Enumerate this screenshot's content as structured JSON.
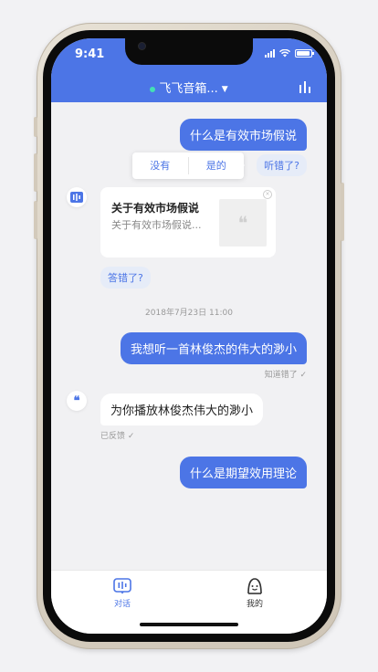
{
  "status_bar": {
    "time": "9:41"
  },
  "header": {
    "device_name": "飞飞音箱...",
    "online_color": "#43e0b4"
  },
  "messages": [
    {
      "role": "user",
      "text": "什么是有效市场假说"
    },
    {
      "role": "user_feedback",
      "text": "听错了?"
    },
    {
      "role": "popup",
      "options": [
        "没有",
        "是的"
      ]
    },
    {
      "role": "card",
      "title": "关于有效市场假说",
      "subtitle": "关于有效市场假说...",
      "quote_mark": "❝"
    },
    {
      "role": "bot_feedback",
      "text": "答错了?"
    },
    {
      "role": "timestamp",
      "text": "2018年7月23日 11:00"
    },
    {
      "role": "user",
      "text": "我想听一首林俊杰的伟大的渺小"
    },
    {
      "role": "user_meta",
      "text": "知道错了"
    },
    {
      "role": "bot",
      "text": "为你播放林俊杰伟大的渺小"
    },
    {
      "role": "bot_meta",
      "text": "已反馈"
    },
    {
      "role": "user",
      "text": "什么是期望效用理论"
    }
  ],
  "tabbar": {
    "tabs": [
      {
        "label": "对话",
        "icon": "chat-icon",
        "active": true
      },
      {
        "label": "我的",
        "icon": "profile-icon",
        "active": false
      }
    ]
  },
  "colors": {
    "accent": "#4c75e6",
    "chip_bg": "#e6ecf8",
    "muted": "#999999"
  }
}
